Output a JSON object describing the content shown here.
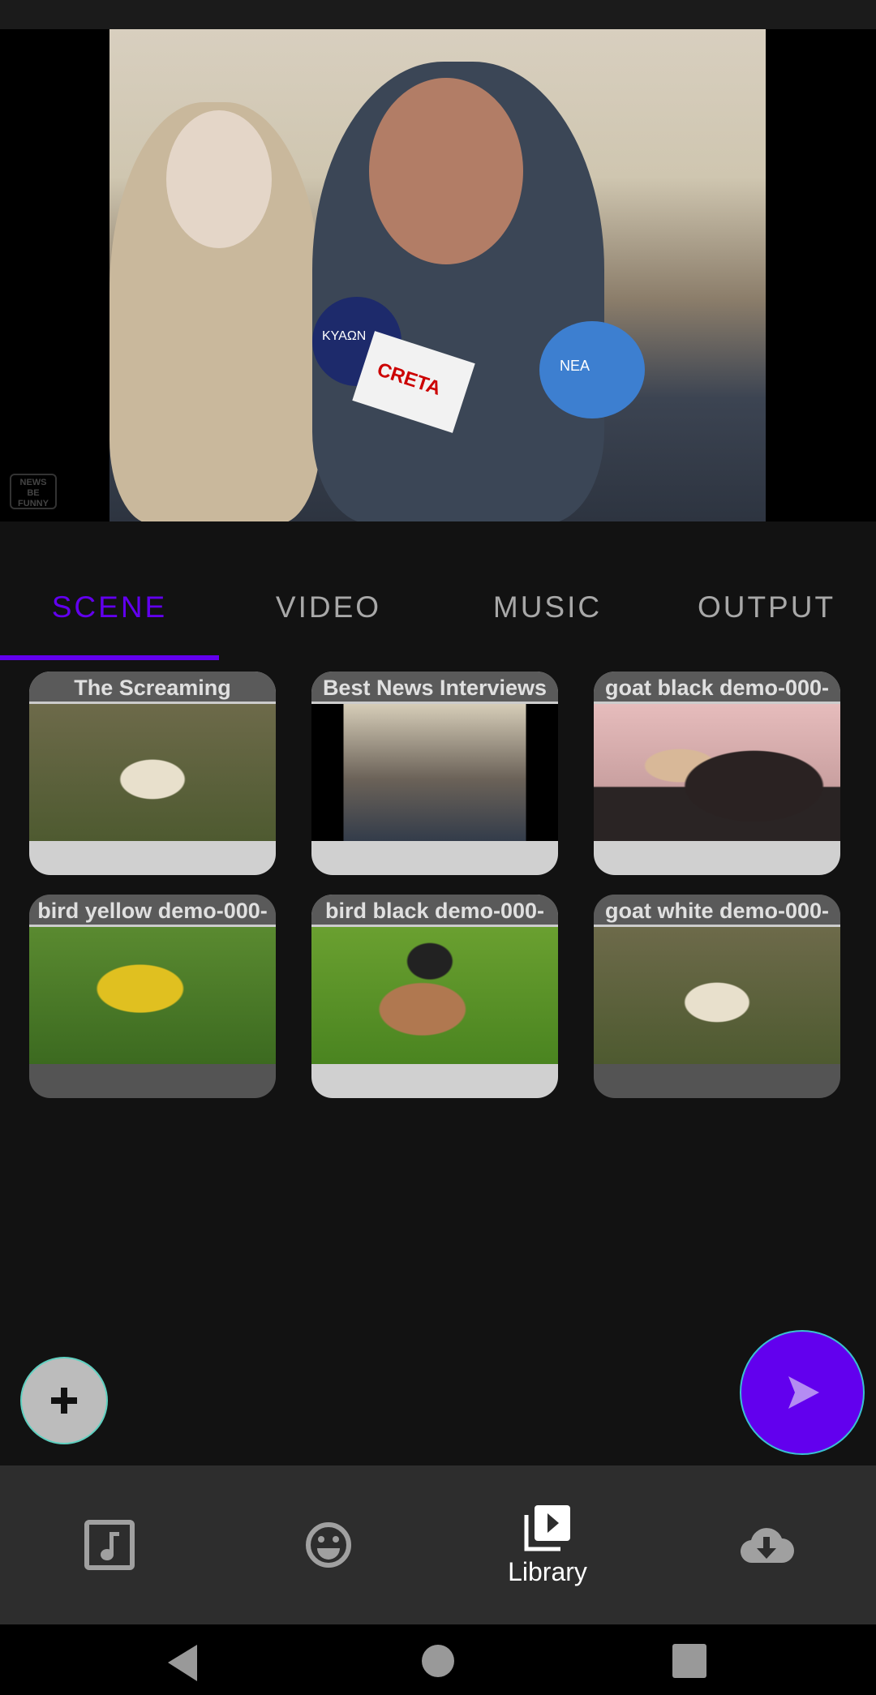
{
  "player": {
    "watermark": "NEWS BE FUNNY",
    "mic_labels": [
      "KYAΩN",
      "CRETA",
      "NEA"
    ]
  },
  "tabs": [
    {
      "label": "SCENE",
      "active": true
    },
    {
      "label": "VIDEO"
    },
    {
      "label": "MUSIC"
    },
    {
      "label": "OUTPUT"
    }
  ],
  "library": {
    "items": [
      {
        "title": "The Screaming"
      },
      {
        "title": "Best News Interviews"
      },
      {
        "title": "goat black demo-000-"
      },
      {
        "title": "bird yellow demo-000-"
      },
      {
        "title": "bird black demo-000-"
      },
      {
        "title": "goat white demo-000-"
      }
    ]
  },
  "fab": {
    "add_icon": "plus-icon",
    "send_icon": "send-icon"
  },
  "bottom_nav": {
    "items": [
      {
        "icon": "music-note-icon",
        "label": ""
      },
      {
        "icon": "emoji-icon",
        "label": ""
      },
      {
        "icon": "video-library-icon",
        "label": "Library",
        "active": true
      },
      {
        "icon": "cloud-download-icon",
        "label": ""
      }
    ]
  },
  "colors": {
    "accent": "#6200ee",
    "tab_inactive": "#a8a8a8",
    "nav_bg": "#2d2d2d"
  }
}
